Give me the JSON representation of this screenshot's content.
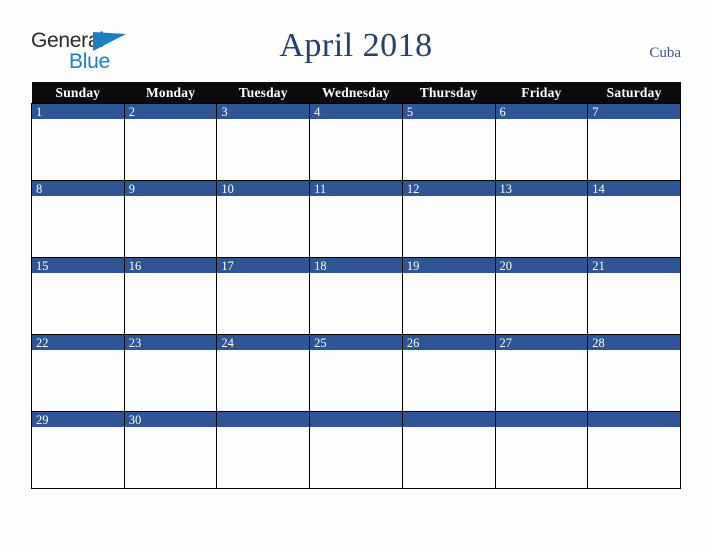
{
  "logo": {
    "line1": "General",
    "line2": "Blue",
    "triangle_color": "#1b7fc4",
    "line1_color": "#2b2b2b",
    "line2_color": "#1b7fc4"
  },
  "header": {
    "title": "April 2018",
    "country": "Cuba",
    "title_color": "#25406e",
    "country_color": "#3c5585"
  },
  "calendar": {
    "month": "April",
    "year": "2018",
    "header_bg": "#0b0b0b",
    "header_fg": "#ffffff",
    "daybar_bg": "#2e5595",
    "daybar_fg": "#ffffff",
    "cell_bg": "#fdfdfd",
    "border_color": "#000000",
    "weekday_headers": [
      "Sunday",
      "Monday",
      "Tuesday",
      "Wednesday",
      "Thursday",
      "Friday",
      "Saturday"
    ],
    "weeks": [
      [
        {
          "date": "1"
        },
        {
          "date": "2"
        },
        {
          "date": "3"
        },
        {
          "date": "4"
        },
        {
          "date": "5"
        },
        {
          "date": "6"
        },
        {
          "date": "7"
        }
      ],
      [
        {
          "date": "8"
        },
        {
          "date": "9"
        },
        {
          "date": "10"
        },
        {
          "date": "11"
        },
        {
          "date": "12"
        },
        {
          "date": "13"
        },
        {
          "date": "14"
        }
      ],
      [
        {
          "date": "15"
        },
        {
          "date": "16"
        },
        {
          "date": "17"
        },
        {
          "date": "18"
        },
        {
          "date": "19"
        },
        {
          "date": "20"
        },
        {
          "date": "21"
        }
      ],
      [
        {
          "date": "22"
        },
        {
          "date": "23"
        },
        {
          "date": "24"
        },
        {
          "date": "25"
        },
        {
          "date": "26"
        },
        {
          "date": "27"
        },
        {
          "date": "28"
        }
      ],
      [
        {
          "date": "29"
        },
        {
          "date": "30"
        },
        {
          "date": ""
        },
        {
          "date": ""
        },
        {
          "date": ""
        },
        {
          "date": ""
        },
        {
          "date": ""
        }
      ]
    ]
  }
}
